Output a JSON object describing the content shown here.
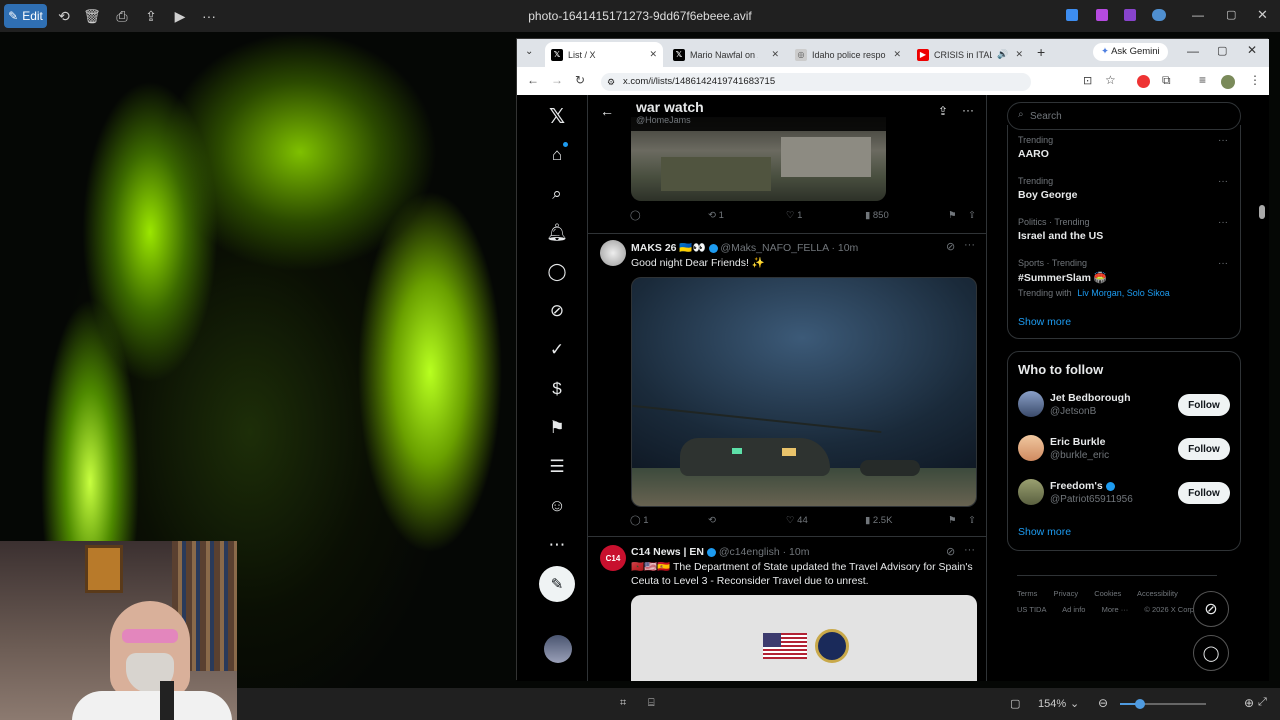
{
  "photos": {
    "edit_label": "Edit",
    "file_name": "photo-1641415171273-9dd67f6ebeee.avif",
    "zoom_level": "154%"
  },
  "browser": {
    "tabs": [
      {
        "label": "List / X",
        "active": true
      },
      {
        "label": "Mario Nawfal on X: \"",
        "active": false
      },
      {
        "label": "Idaho police respond",
        "active": false
      },
      {
        "label": "CRISIS in ITALY - I",
        "active": false
      }
    ],
    "ask_gemini": "Ask Gemini",
    "url": "x.com/i/lists/1486142419741683715"
  },
  "list": {
    "title": "war watch",
    "handle": "@HomeJams"
  },
  "tweets": [
    {
      "replies": "",
      "retweets": "1",
      "likes": "1",
      "views": "850"
    },
    {
      "name": "MAKS 26 🇺🇦👀",
      "handle": "@Maks_NAFO_FELLA",
      "time": "· 10m",
      "text": "Good night Dear Friends! ✨",
      "replies": "1",
      "retweets": "",
      "likes": "44",
      "views": "2.5K"
    },
    {
      "name": "C14 News | EN",
      "handle": "@c14english",
      "time": "· 10m",
      "text": "🇲🇦🇺🇸🇪🇸 The Department of State updated the Travel Advisory for Spain's Ceuta to Level 3 - Reconsider Travel due to unrest."
    }
  ],
  "sidebar": {
    "search_placeholder": "Search",
    "trends": [
      {
        "context": "Trending",
        "name": "AARO",
        "extra": ""
      },
      {
        "context": "Trending",
        "name": "Boy George",
        "extra": ""
      },
      {
        "context": "Politics · Trending",
        "name": "Israel and the US",
        "extra": ""
      },
      {
        "context": "Sports · Trending",
        "name": "#SummerSlam 🏟️",
        "extra": "Trending with"
      }
    ],
    "trend_links": [
      "Liv Morgan",
      "Solo Sikoa"
    ],
    "show_more": "Show more",
    "who_to_follow_title": "Who to follow",
    "follow_label": "Follow",
    "suggestions": [
      {
        "name": "Jet Bedborough",
        "handle": "@JetsonB"
      },
      {
        "name": "Eric Burkle",
        "handle": "@burkle_eric"
      },
      {
        "name": "Freedom's",
        "handle": "@Patriot65911956"
      }
    ],
    "footer": [
      "Terms",
      "Privacy",
      "Cookies",
      "Accessibility",
      "US TIDA",
      "Ad info",
      "More ···",
      "© 2026 X Corp."
    ]
  },
  "colors": {
    "x_blue": "#1d9bf0",
    "follow_bg": "#eff3f4",
    "photos_accent": "#2f6fb3"
  }
}
